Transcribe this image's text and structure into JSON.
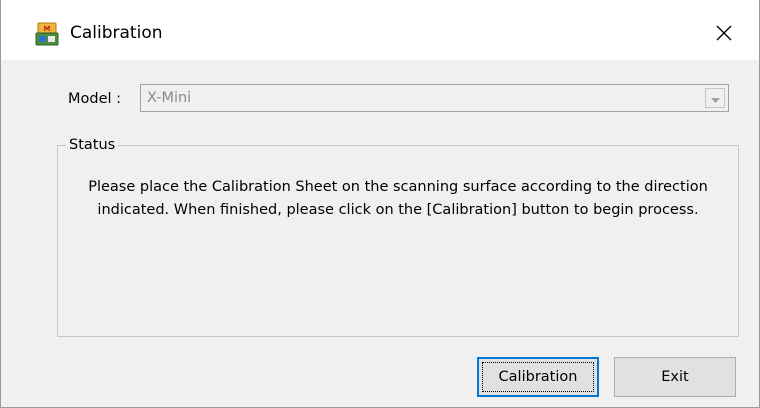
{
  "window": {
    "title": "Calibration",
    "icon": "scanner-app-icon",
    "close_icon": "close-icon"
  },
  "model": {
    "label": "Model :",
    "value": "X-Mini",
    "dropdown_icon": "chevron-down-icon",
    "disabled": true
  },
  "status": {
    "legend": "Status",
    "message_line1": "Please place the Calibration Sheet on the scanning surface according to the direction",
    "message_line2": "indicated. When finished, please click on the [Calibration] button to begin process."
  },
  "buttons": {
    "calibration_label": "Calibration",
    "exit_label": "Exit"
  },
  "colors": {
    "window_bg": "#f0f0f0",
    "focus_border": "#0078d7",
    "disabled_text": "#8a8a8a"
  }
}
